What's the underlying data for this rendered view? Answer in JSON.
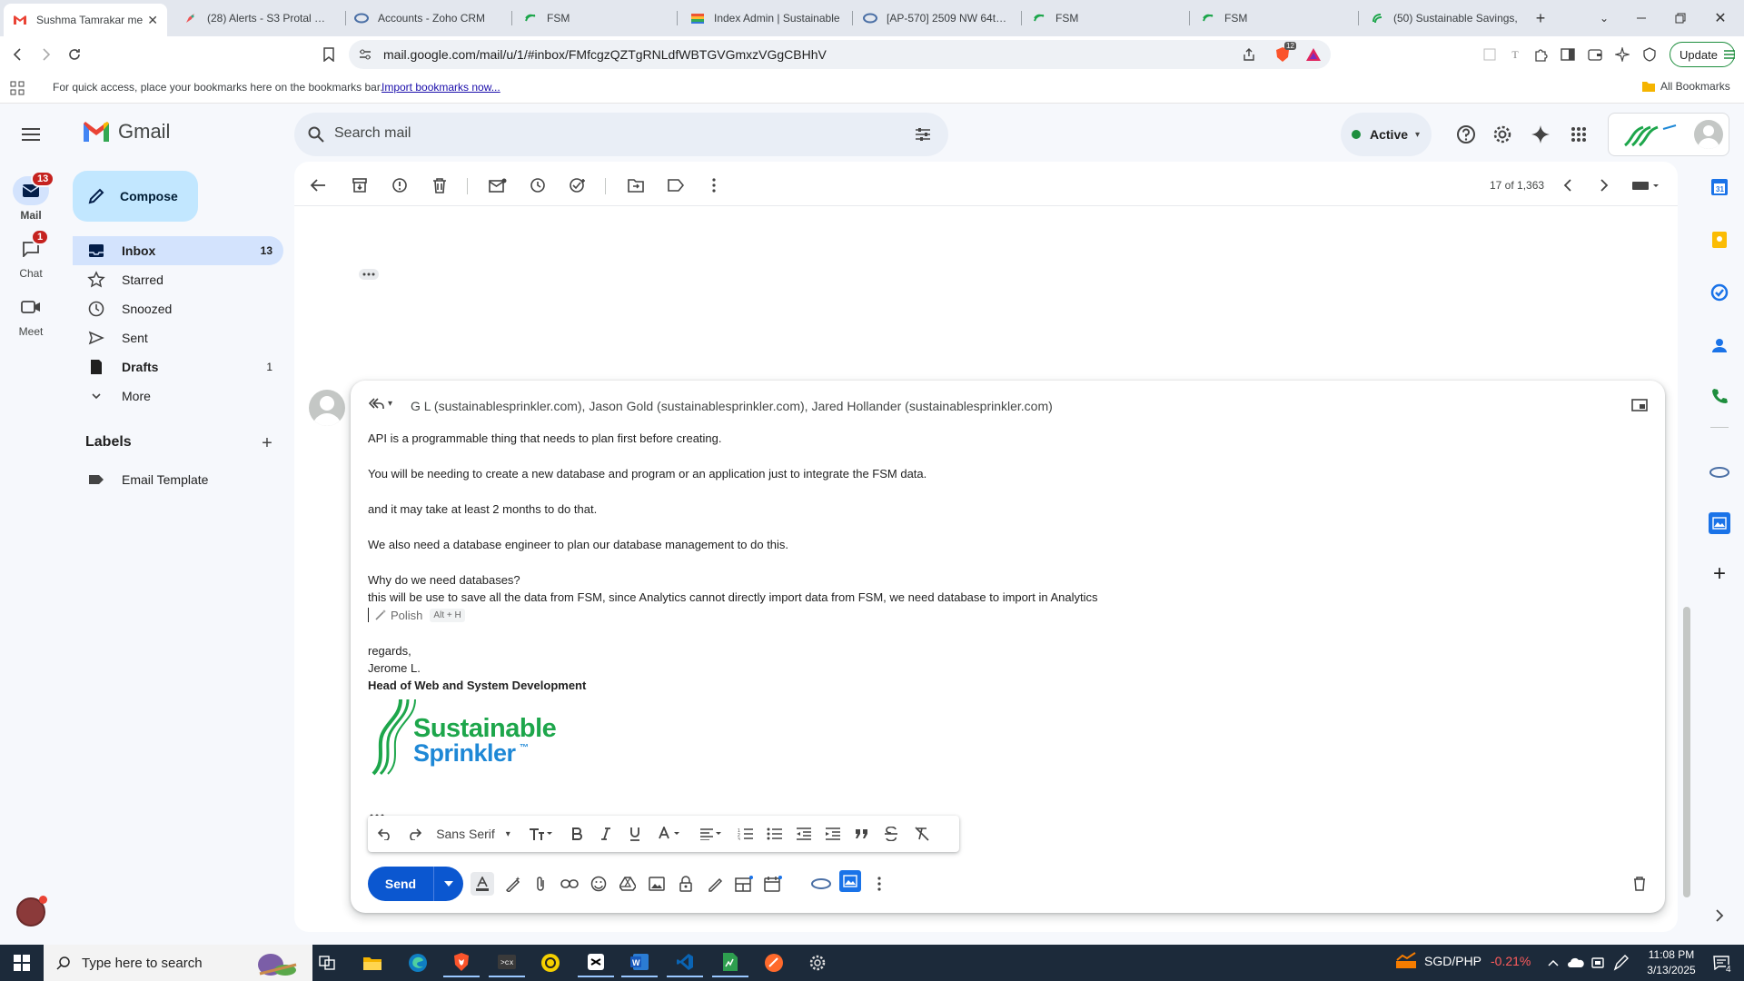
{
  "browser": {
    "tabs": [
      {
        "title": "Sushma Tamrakar me",
        "favicon": "gmail-icon",
        "active": true
      },
      {
        "title": "(28) Alerts - S3 Protal - Ta",
        "favicon": "rocket-icon"
      },
      {
        "title": "Accounts - Zoho CRM",
        "favicon": "zoho-icon"
      },
      {
        "title": "FSM",
        "favicon": "fsm-icon"
      },
      {
        "title": "Index Admin | Sustainable",
        "favicon": "index-admin-icon"
      },
      {
        "title": "[AP-570] 2509 NW 64th B",
        "favicon": "zoho-icon"
      },
      {
        "title": "FSM",
        "favicon": "fsm-icon"
      },
      {
        "title": "FSM",
        "favicon": "fsm-icon"
      },
      {
        "title": "(50) Sustainable Savings, ",
        "favicon": "savings-icon"
      }
    ],
    "url": "mail.google.com/mail/u/1/#inbox/FMfcgzQZTgRNLdfWBTGVGmxzVGgCBHhV",
    "update_label": "Update",
    "brave_badge_count": "12",
    "bookmarks_hint": "For quick access, place your bookmarks here on the bookmarks bar.",
    "import_bookmarks": "Import bookmarks now...",
    "all_bookmarks": "All Bookmarks"
  },
  "gmail": {
    "logo_text": "Gmail",
    "search_placeholder": "Search mail",
    "status": "Active",
    "compose": "Compose",
    "rail": [
      {
        "label": "Mail",
        "badge": "13"
      },
      {
        "label": "Chat",
        "badge": "1"
      },
      {
        "label": "Meet",
        "badge": ""
      }
    ],
    "nav": [
      {
        "label": "Inbox",
        "count": "13"
      },
      {
        "label": "Starred",
        "count": ""
      },
      {
        "label": "Snoozed",
        "count": ""
      },
      {
        "label": "Sent",
        "count": ""
      },
      {
        "label": "Drafts",
        "count": "1"
      },
      {
        "label": "More",
        "count": ""
      }
    ],
    "labels_heading": "Labels",
    "labels": [
      {
        "label": "Email Template"
      }
    ],
    "pagination": "17 of 1,363"
  },
  "reply": {
    "recipients": "G L (sustainablesprinkler.com), Jason Gold (sustainablesprinkler.com), Jared Hollander (sustainablesprinkler.com)",
    "lines": [
      " API is a programmable thing that needs to plan first before creating.",
      "You will be needing to create a new database and program or an application just to integrate the FSM data.",
      "and it may take at least 2 months to do that.",
      "We also need a database engineer to plan our database management to do this.",
      "Why do we need databases?",
      "this will be use to save all the data from FSM, since Analytics cannot directly import data from FSM, we need database to import in Analytics"
    ],
    "polish_label": "Polish",
    "polish_shortcut": "Alt + H",
    "signoff": "regards,",
    "name": "Jerome L.",
    "title": "Head of Web and System Development",
    "logo_line1": "Sustainable",
    "logo_line2": "Sprinkler",
    "logo_tm": "™",
    "font_name": "Sans Serif",
    "send": "Send"
  },
  "taskbar": {
    "search_placeholder": "Type here to search",
    "ticker": "SGD/PHP",
    "ticker_change": "-0.21%",
    "time": "11:08 PM",
    "date": "3/13/2025",
    "notification_count": "4"
  },
  "colors": {
    "gmail_red": "#ea4335",
    "brand_blue": "#0b57d0",
    "selected_nav": "#d3e3fd",
    "compose_bg": "#c2e7ff",
    "sprinkler_green": "#1da64b",
    "sprinkler_blue": "#1e88d6",
    "taskbar": "#1c2a3a",
    "ticker_red": "#ff5c5c"
  }
}
